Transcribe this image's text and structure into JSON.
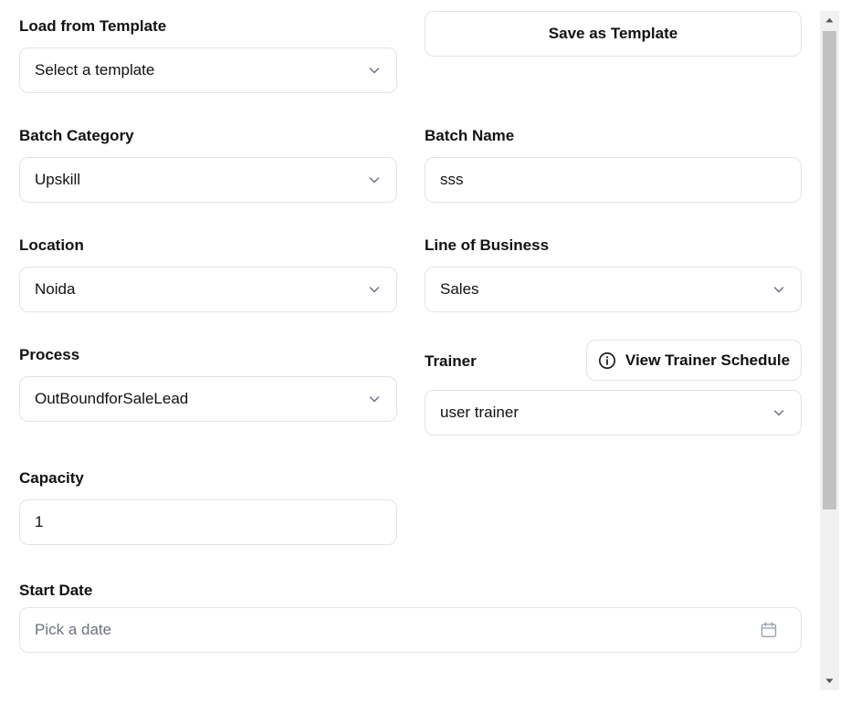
{
  "form": {
    "load_template": {
      "label": "Load from Template",
      "placeholder": "Select a template"
    },
    "save_template_label": "Save as Template",
    "batch_category": {
      "label": "Batch Category",
      "value": "Upskill"
    },
    "batch_name": {
      "label": "Batch Name",
      "value": "sss"
    },
    "location": {
      "label": "Location",
      "value": "Noida"
    },
    "line_of_business": {
      "label": "Line of Business",
      "value": "Sales"
    },
    "process": {
      "label": "Process",
      "value": "OutBoundforSaleLead"
    },
    "trainer": {
      "label": "Trainer",
      "value": "user trainer",
      "schedule_button_label": "View Trainer Schedule"
    },
    "capacity": {
      "label": "Capacity",
      "value": "1"
    },
    "start_date": {
      "label": "Start Date",
      "placeholder": "Pick a date"
    }
  },
  "icons": {
    "select_chevron": "chevron-down-icon",
    "info": "info-icon",
    "calendar": "calendar-icon"
  },
  "colors": {
    "border": "#e4e4e7",
    "text": "#111111",
    "placeholder": "#6b7280",
    "scrollbar_track": "#f1f1f1",
    "scrollbar_thumb": "#c1c1c1"
  }
}
